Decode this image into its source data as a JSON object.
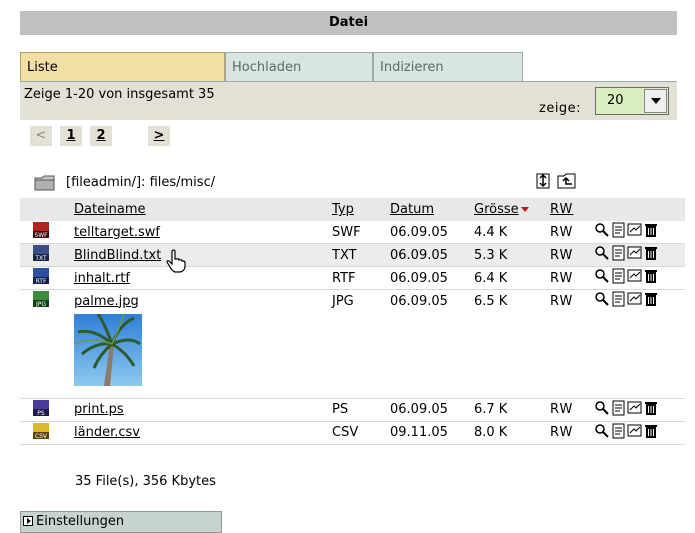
{
  "header": {
    "title": "Datei"
  },
  "tabs": [
    {
      "label": "Liste",
      "active": true
    },
    {
      "label": "Hochladen",
      "active": false
    },
    {
      "label": "Indizieren",
      "active": false
    }
  ],
  "status": {
    "count_text": "Zeige 1-20 von insgesamt 35",
    "show_label": "zeige:",
    "show_value": "20"
  },
  "pager": {
    "prev": "<",
    "pages": [
      "1",
      "2"
    ],
    "next": ">"
  },
  "path": {
    "text": "[fileadmin/]: files/misc/"
  },
  "table": {
    "columns": [
      "Dateiname",
      "Typ",
      "Datum",
      "Grösse",
      "RW"
    ],
    "rows": [
      {
        "icon": "swf-file-icon",
        "name": "telltarget.swf",
        "type": "SWF",
        "date": "06.09.05",
        "size": "4.4 K",
        "rw": "RW"
      },
      {
        "icon": "txt-file-icon",
        "name": "BlindBlind.txt",
        "type": "TXT",
        "date": "06.09.05",
        "size": "5.3 K",
        "rw": "RW"
      },
      {
        "icon": "rtf-file-icon",
        "name": "inhalt.rtf",
        "type": "RTF",
        "date": "06.09.05",
        "size": "6.4 K",
        "rw": "RW"
      },
      {
        "icon": "jpg-file-icon",
        "name": "palme.jpg",
        "type": "JPG",
        "date": "06.09.05",
        "size": "6.5 K",
        "rw": "RW"
      },
      {
        "icon": "ps-file-icon",
        "name": "print.ps",
        "type": "PS",
        "date": "06.09.05",
        "size": "6.7 K",
        "rw": "RW"
      },
      {
        "icon": "csv-file-icon",
        "name": "länder.csv",
        "type": "CSV",
        "date": "09.11.05",
        "size": "8.0 K",
        "rw": "RW"
      }
    ]
  },
  "summary": "35 File(s), 356 Kbytes",
  "settings": {
    "label": "Einstellungen"
  },
  "colors": {
    "active_tab": "#f2dfa6",
    "inactive_tab": "#d9e5e1",
    "select_bg": "#d9efbf",
    "sort_arrow": "#d01010"
  }
}
